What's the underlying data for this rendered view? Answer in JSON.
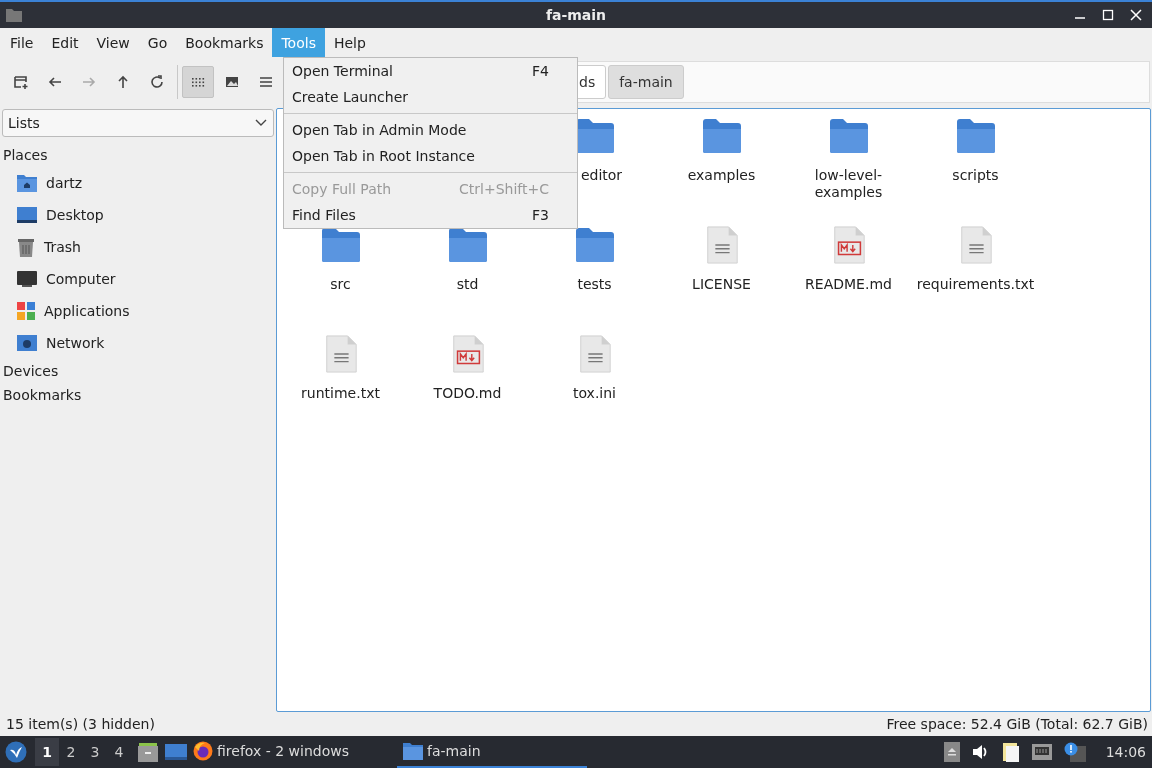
{
  "window": {
    "title": "fa-main"
  },
  "menubar": [
    {
      "label": "File",
      "selected": false
    },
    {
      "label": "Edit",
      "selected": false
    },
    {
      "label": "View",
      "selected": false
    },
    {
      "label": "Go",
      "selected": false
    },
    {
      "label": "Bookmarks",
      "selected": false
    },
    {
      "label": "Tools",
      "selected": true
    },
    {
      "label": "Help",
      "selected": false
    }
  ],
  "toolbar": {
    "navigation": [
      {
        "kind": "new-tab",
        "disabled": false
      },
      {
        "kind": "back",
        "disabled": false
      },
      {
        "kind": "forward",
        "disabled": true
      },
      {
        "kind": "up",
        "disabled": false
      },
      {
        "kind": "reload",
        "disabled": false
      }
    ],
    "views": [
      {
        "kind": "icon-view",
        "selected": true
      },
      {
        "kind": "thumbnail-view",
        "selected": false
      },
      {
        "kind": "list-view",
        "selected": false
      }
    ]
  },
  "path_bar": [
    {
      "label": "ds",
      "selected": false
    },
    {
      "label": "fa-main",
      "selected": true
    }
  ],
  "tools_menu": [
    [
      {
        "label": "Open Terminal",
        "shortcut": "F4",
        "disabled": false
      },
      {
        "label": "Create Launcher",
        "disabled": false
      }
    ],
    [
      {
        "label": "Open Tab in Admin Mode",
        "disabled": false
      },
      {
        "label": "Open Tab in Root Instance",
        "disabled": false
      }
    ],
    [
      {
        "label": "Copy Full Path",
        "shortcut": "Ctrl+Shift+C",
        "disabled": true
      },
      {
        "label": "Find Files",
        "shortcut": "F3",
        "disabled": false
      }
    ]
  ],
  "sidebar": {
    "dropdown": "Lists",
    "sections": [
      {
        "title": "Places",
        "items": [
          {
            "label": "dartz",
            "kind": "home"
          },
          {
            "label": "Desktop",
            "kind": "desktop"
          },
          {
            "label": "Trash",
            "kind": "trash"
          },
          {
            "label": "Computer",
            "kind": "computer"
          },
          {
            "label": "Applications",
            "kind": "apps"
          },
          {
            "label": "Network",
            "kind": "network"
          }
        ]
      },
      {
        "title": "Devices"
      },
      {
        "title": "Bookmarks"
      }
    ]
  },
  "files": [
    {
      "name": "editor",
      "kind": "folder"
    },
    {
      "name": "examples",
      "kind": "folder"
    },
    {
      "name": "low-level-examples",
      "kind": "folder"
    },
    {
      "name": "scripts",
      "kind": "folder"
    },
    {
      "name": "src",
      "kind": "folder"
    },
    {
      "name": "std",
      "kind": "folder"
    },
    {
      "name": "tests",
      "kind": "folder"
    },
    {
      "name": "LICENSE",
      "kind": "text"
    },
    {
      "name": "README.md",
      "kind": "markdown"
    },
    {
      "name": "requirements.txt",
      "kind": "text"
    },
    {
      "name": "runtime.txt",
      "kind": "text"
    },
    {
      "name": "TODO.md",
      "kind": "markdown"
    },
    {
      "name": "tox.ini",
      "kind": "text"
    }
  ],
  "status_bar": {
    "left": "15 item(s) (3 hidden)",
    "right": "Free space: 52.4 GiB (Total: 62.7 GiB)"
  },
  "taskbar": {
    "workspaces": [
      {
        "label": "1",
        "selected": true
      },
      {
        "label": "2",
        "selected": false
      },
      {
        "label": "3",
        "selected": false
      },
      {
        "label": "4",
        "selected": false
      }
    ],
    "tasks": [
      {
        "label": "firefox - 2 windows",
        "kind": "browser",
        "selected": false
      },
      {
        "label": "fa-main",
        "kind": "folder",
        "selected": true
      }
    ],
    "clock": "14:06"
  }
}
